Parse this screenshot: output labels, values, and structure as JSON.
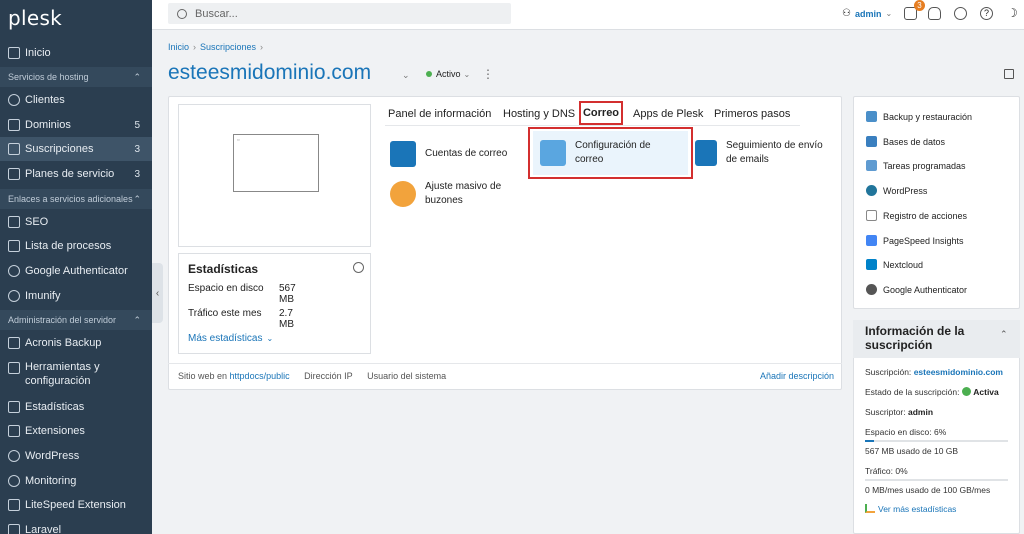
{
  "brand": "plesk",
  "sidebar": {
    "items": [
      {
        "label": "Inicio",
        "icon": "home-icon"
      },
      {
        "section": "Servicios de hosting"
      },
      {
        "label": "Clientes",
        "icon": "user-icon"
      },
      {
        "label": "Dominios",
        "icon": "monitor-icon",
        "count": "5"
      },
      {
        "label": "Suscripciones",
        "icon": "grid-icon",
        "count": "3"
      },
      {
        "label": "Planes de servicio",
        "icon": "doc-icon",
        "count": "3"
      },
      {
        "section": "Enlaces a servicios adicionales"
      },
      {
        "label": "SEO",
        "icon": "seo-icon"
      },
      {
        "label": "Lista de procesos",
        "icon": "list-icon"
      },
      {
        "label": "Google Authenticator",
        "icon": "google-icon"
      },
      {
        "label": "Imunify",
        "icon": "gear-icon"
      },
      {
        "section": "Administración del servidor"
      },
      {
        "label": "Acronis Backup",
        "icon": "acronis-icon"
      },
      {
        "label": "Herramientas y configuración",
        "icon": "tools-icon"
      },
      {
        "label": "Estadísticas",
        "icon": "stats-icon"
      },
      {
        "label": "Extensiones",
        "icon": "extensions-icon"
      },
      {
        "label": "WordPress",
        "icon": "wordpress-icon"
      },
      {
        "label": "Monitoring",
        "icon": "monitoring-icon"
      },
      {
        "label": "LiteSpeed Extension",
        "icon": "litespeed-icon"
      },
      {
        "label": "Laravel",
        "icon": "laravel-icon"
      }
    ]
  },
  "topbar": {
    "search_placeholder": "Buscar...",
    "user": "admin",
    "notifications": "3"
  },
  "breadcrumb": [
    "Inicio",
    "Suscripciones"
  ],
  "domain_title": "esteesmidominio.com",
  "status": "Activo",
  "tabs": [
    "Panel de información",
    "Hosting y DNS",
    "Correo",
    "Apps de Plesk",
    "Primeros pasos"
  ],
  "tools": [
    {
      "label": "Cuentas de correo",
      "icon": "mail-accounts-icon"
    },
    {
      "label": "Configuración de correo",
      "icon": "mail-settings-icon"
    },
    {
      "label": "Seguimiento de envío de emails",
      "icon": "email-tracking-icon"
    },
    {
      "label": "Ajuste masivo de buzones",
      "icon": "mailbox-bulk-icon"
    }
  ],
  "stats": {
    "title": "Estadísticas",
    "disk_label": "Espacio en disco",
    "disk_value": "567 MB",
    "traffic_label": "Tráfico este mes",
    "traffic_value": "2.7 MB",
    "more": "Más estadísticas"
  },
  "footer": {
    "website_prefix": "Sitio web en",
    "website_link": "httpdocs/public",
    "ip": "Dirección IP",
    "system_user": "Usuario del sistema",
    "add_description": "Añadir descripción"
  },
  "right_tools": [
    "Backup y restauración",
    "Bases de datos",
    "Tareas programadas",
    "WordPress",
    "Registro de acciones",
    "PageSpeed Insights",
    "Nextcloud",
    "Google Authenticator"
  ],
  "subscription_info": {
    "title": "Información de la suscripción",
    "subscription_label": "Suscripción:",
    "subscription_value": "esteesmidominio.com",
    "state_label": "Estado de la suscripción:",
    "state_value": "Activa",
    "subscriber_label": "Suscriptor:",
    "subscriber_value": "admin",
    "disk_label": "Espacio en disco: 6%",
    "disk_percent": 6,
    "disk_usage": "567 MB usado de 10 GB",
    "traffic_label": "Tráfico: 0%",
    "traffic_percent": 0,
    "traffic_usage": "0 MB/mes usado de 100 GB/mes",
    "more_stats": "Ver más estadísticas"
  },
  "colors": {
    "accent": "#1a75b8",
    "sidebar": "#2b3e50",
    "highlight": "#d32f2f",
    "active": "#4caf50"
  }
}
